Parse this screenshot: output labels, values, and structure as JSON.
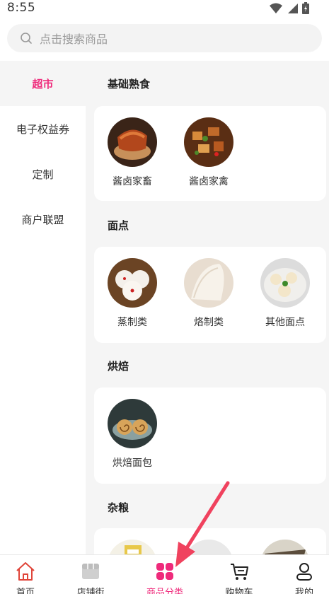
{
  "status_bar": {
    "time": "8:55"
  },
  "search": {
    "placeholder": "点击搜索商品"
  },
  "sidebar": {
    "items": [
      {
        "label": "超市",
        "active": true
      },
      {
        "label": "电子权益券",
        "active": false
      },
      {
        "label": "定制",
        "active": false
      },
      {
        "label": "商户联盟",
        "active": false
      }
    ]
  },
  "sections": [
    {
      "title": "基础熟食",
      "items": [
        {
          "label": "酱卤家畜"
        },
        {
          "label": "酱卤家禽"
        }
      ]
    },
    {
      "title": "面点",
      "items": [
        {
          "label": "蒸制类"
        },
        {
          "label": "烙制类"
        },
        {
          "label": "其他面点"
        }
      ]
    },
    {
      "title": "烘焙",
      "items": [
        {
          "label": "烘焙面包"
        }
      ]
    },
    {
      "title": "杂粮",
      "items": []
    }
  ],
  "bottom_nav": {
    "items": [
      {
        "label": "首页",
        "icon": "home-icon"
      },
      {
        "label": "店铺街",
        "icon": "shop-street-icon"
      },
      {
        "label": "商品分类",
        "icon": "category-icon",
        "active": true
      },
      {
        "label": "购物车",
        "icon": "cart-icon"
      },
      {
        "label": "我的",
        "icon": "profile-icon"
      }
    ]
  },
  "colors": {
    "accent": "#ef2a7b",
    "arrow": "#f0425e",
    "background": "#f5f5f5"
  }
}
